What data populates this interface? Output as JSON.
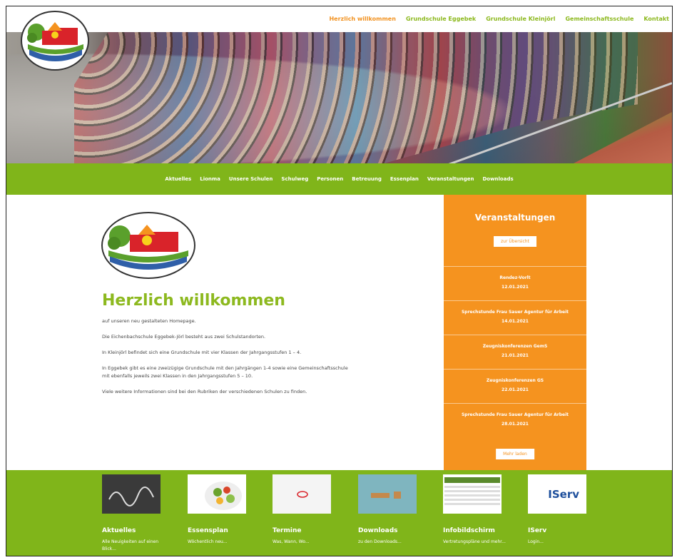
{
  "nav": {
    "links": [
      "Herzlich willkommen",
      "Grundschule Eggebek",
      "Grundschule Kleinjörl",
      "Gemeinschaftsschule",
      "Kontakt"
    ],
    "active_index": 0
  },
  "menu": {
    "items": [
      "Aktuelles",
      "Lionma",
      "Unsere Schulen",
      "Schulweg",
      "Personen",
      "Betreuung",
      "Essenplan",
      "Veranstaltungen",
      "Downloads"
    ]
  },
  "main": {
    "title": "Herzlich willkommen",
    "paragraphs": [
      "auf unseren neu gestalteten Homepage.",
      "Die Eichenbachschule Eggebek-Jörl besteht aus zwei Schulstandorten.",
      "In Kleinjörl befindet sich eine Grundschule mit vier Klassen der Jahrgangsstufen 1 – 4.",
      "In Eggebek gibt es eine zweizügige Grundschule mit den Jahrgängen 1-4 sowie eine Gemeinschaftsschule mit ebenfalls jeweils zwei Klassen in den Jahrgangsstufen 5 – 10.",
      "Viele weitere Informationen sind bei den Rubriken der verschiedenen Schulen zu finden."
    ]
  },
  "events": {
    "title": "Veranstaltungen",
    "overview_label": "zur Übersicht",
    "more_label": "Mehr laden",
    "items": [
      {
        "title": "Rendez-Vorlt",
        "date": "12.01.2021"
      },
      {
        "title": "Sprechstunde Frau Sauer Agentur für Arbeit",
        "date": "14.01.2021"
      },
      {
        "title": "Zeugniskonferenzen GemS",
        "date": "21.01.2021"
      },
      {
        "title": "Zeugniskonferenzen GS",
        "date": "22.01.2021"
      },
      {
        "title": "Sprechstunde Frau Sauer Agentur für Arbeit",
        "date": "28.01.2021"
      }
    ]
  },
  "footer": {
    "cards": [
      {
        "title": "Aktuelles",
        "subtitle": "Alle Neuigkeiten auf einen Blick...",
        "icon": "chalkboard-image"
      },
      {
        "title": "Essensplan",
        "subtitle": "Wöchentlich neu...",
        "icon": "salad-image"
      },
      {
        "title": "Termine",
        "subtitle": "Was, Wann, Wo...",
        "icon": "calendar-image"
      },
      {
        "title": "Downloads",
        "subtitle": "zu den Downloads...",
        "icon": "download-image"
      },
      {
        "title": "Infobildschirm",
        "subtitle": "Vertretungspläne und mehr...",
        "icon": "infoscreen-image"
      },
      {
        "title": "IServ",
        "subtitle": "Login...",
        "icon": "iserv-logo",
        "logo_text": "IServ"
      }
    ]
  },
  "colors": {
    "green": "#80b51a",
    "orange": "#f5931f",
    "title_green": "#8db91f"
  }
}
